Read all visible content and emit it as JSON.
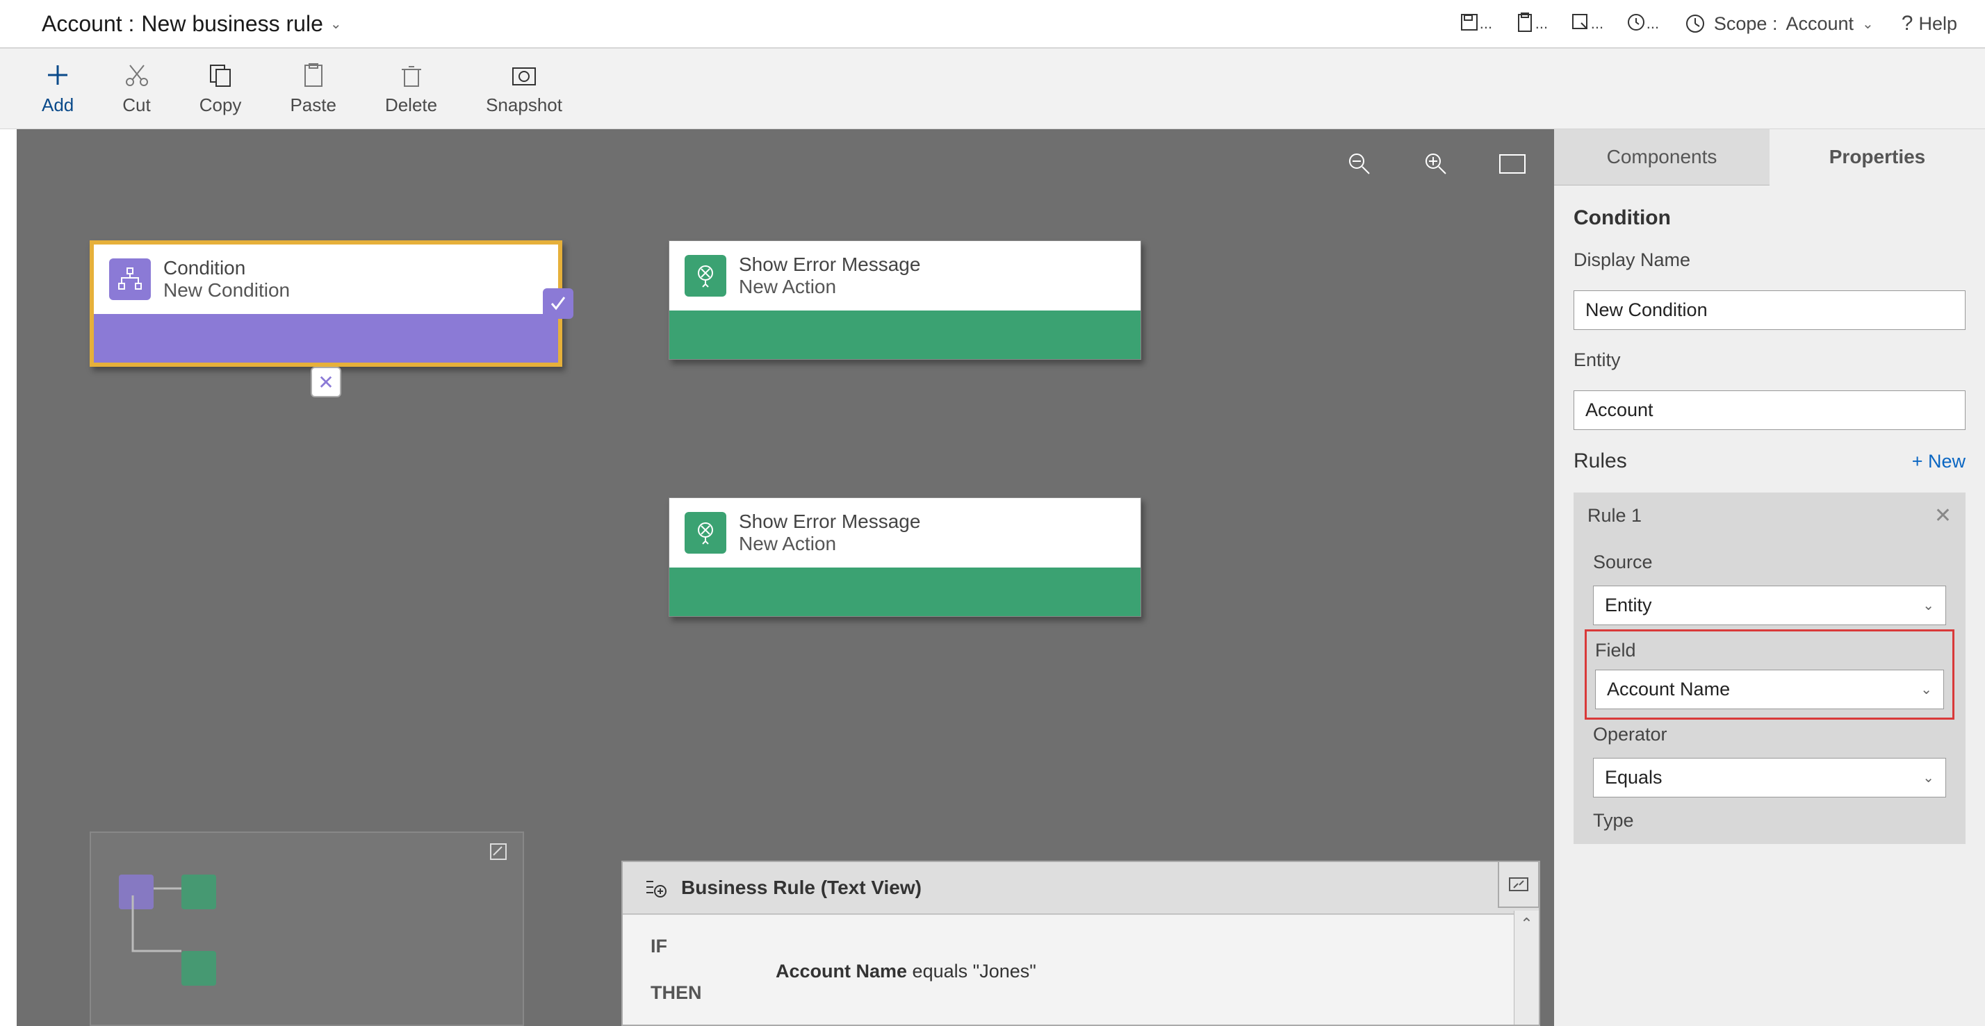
{
  "header": {
    "title_prefix": "Account :",
    "title_name": "New business rule",
    "scope_label": "Scope :",
    "scope_value": "Account",
    "help_label": "Help"
  },
  "toolbar": {
    "add": "Add",
    "cut": "Cut",
    "copy": "Copy",
    "paste": "Paste",
    "delete": "Delete",
    "snapshot": "Snapshot"
  },
  "canvas": {
    "condition": {
      "title": "Condition",
      "subtitle": "New Condition"
    },
    "action1": {
      "title": "Show Error Message",
      "subtitle": "New Action"
    },
    "action2": {
      "title": "Show Error Message",
      "subtitle": "New Action"
    }
  },
  "text_view": {
    "title": "Business Rule (Text View)",
    "if_label": "IF",
    "then_label": "THEN",
    "if_text_field": "Account Name",
    "if_text_rest": " equals \"Jones\""
  },
  "props": {
    "tabs": {
      "components": "Components",
      "properties": "Properties"
    },
    "section": "Condition",
    "display_name_label": "Display Name",
    "display_name_value": "New Condition",
    "entity_label": "Entity",
    "entity_value": "Account",
    "rules_label": "Rules",
    "new_label": "+  New",
    "rule1_label": "Rule 1",
    "source_label": "Source",
    "source_value": "Entity",
    "field_label": "Field",
    "field_value": "Account Name",
    "operator_label": "Operator",
    "operator_value": "Equals",
    "type_label": "Type"
  }
}
